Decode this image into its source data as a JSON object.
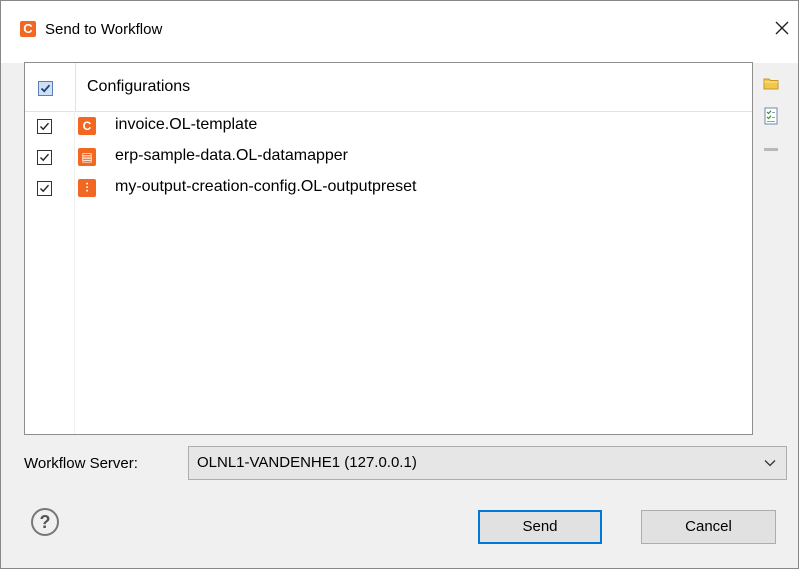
{
  "window": {
    "title": "Send to Workflow",
    "app_icon_letter": "C",
    "close_glyph": "close-icon"
  },
  "configurations": {
    "header_label": "Configurations",
    "header_checked": true,
    "items": [
      {
        "label": "invoice.OL-template",
        "checked": true,
        "icon": "template-icon",
        "icon_glyph": "C"
      },
      {
        "label": "erp-sample-data.OL-datamapper",
        "checked": true,
        "icon": "datamapper-icon",
        "icon_glyph": "▤"
      },
      {
        "label": "my-output-creation-config.OL-outputpreset",
        "checked": true,
        "icon": "outputpreset-icon",
        "icon_glyph": "⫶"
      }
    ]
  },
  "side_tools": [
    {
      "name": "open-folder-icon"
    },
    {
      "name": "checklist-icon"
    },
    {
      "name": "remove-icon"
    }
  ],
  "workflow_server": {
    "label": "Workflow Server:",
    "selected": "OLNL1-VANDENHE1 (127.0.0.1)"
  },
  "buttons": {
    "send": "Send",
    "cancel": "Cancel",
    "help_glyph": "?"
  },
  "colors": {
    "accent": "#f26722",
    "focus": "#0078d7"
  }
}
